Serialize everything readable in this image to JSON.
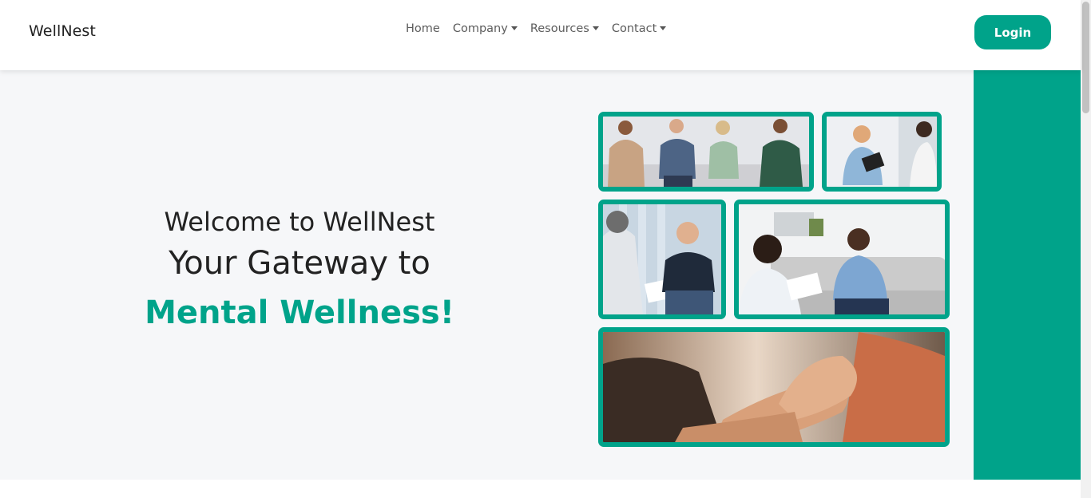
{
  "brand": "WellNest",
  "nav": {
    "items": [
      {
        "label": "Home",
        "dropdown": false
      },
      {
        "label": "Company",
        "dropdown": true
      },
      {
        "label": "Resources",
        "dropdown": true
      },
      {
        "label": "Contact",
        "dropdown": true
      }
    ]
  },
  "login_label": "Login",
  "hero": {
    "line1": "Welcome to WellNest",
    "line2": "Your Gateway to",
    "line3": "Mental Wellness!"
  },
  "colors": {
    "accent": "#00a38a",
    "hero_background": "#f6f7f9",
    "text": "#222222"
  },
  "images": [
    {
      "name": "group-therapy-photo",
      "alt": ""
    },
    {
      "name": "counseling-session-photo",
      "alt": ""
    },
    {
      "name": "man-talking-to-therapist-photo",
      "alt": ""
    },
    {
      "name": "therapist-with-client-on-sofa-photo",
      "alt": ""
    },
    {
      "name": "holding-hands-photo",
      "alt": ""
    }
  ]
}
